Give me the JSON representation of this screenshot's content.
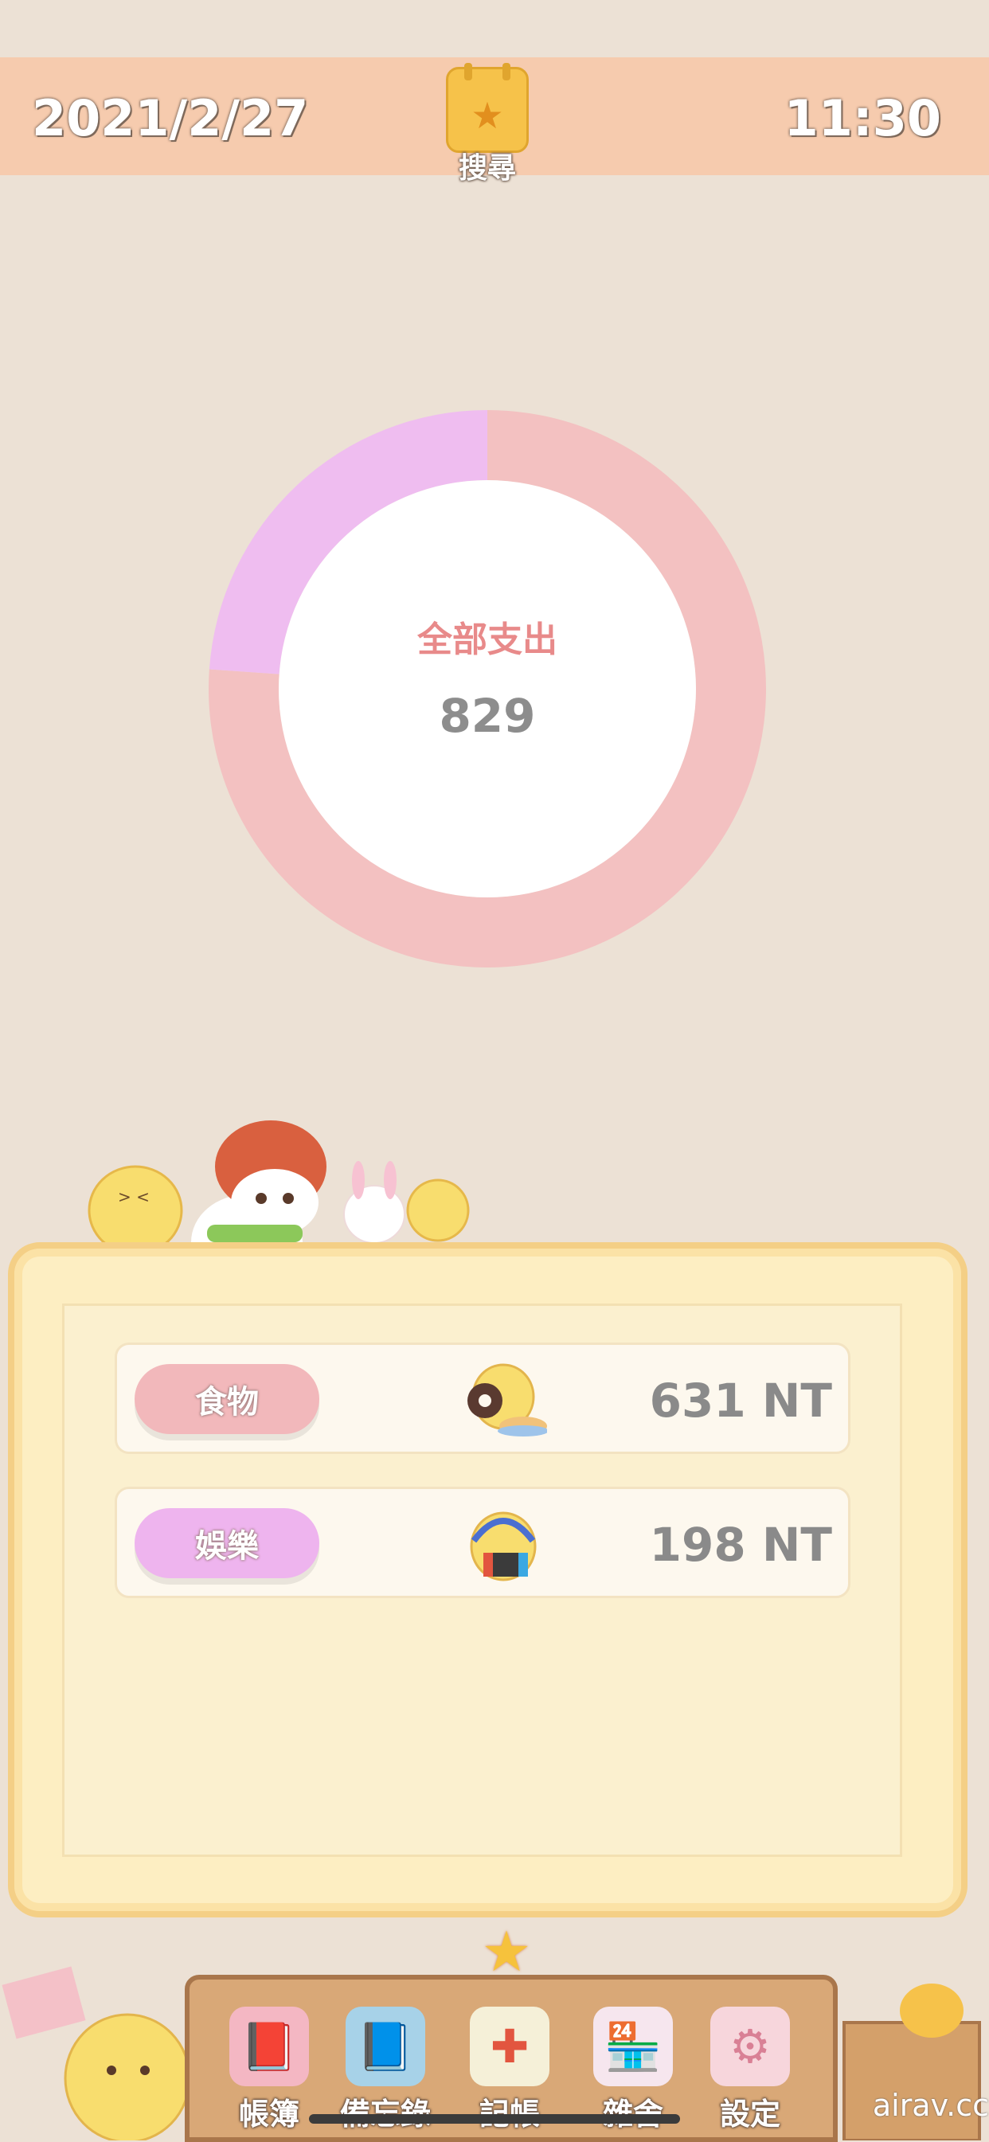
{
  "header": {
    "date": "2021/2/27",
    "time": "11:30",
    "search_label": "搜尋"
  },
  "summary": {
    "title": "全部支出",
    "total": "829"
  },
  "chart_data": {
    "type": "pie",
    "categories": [
      "食物",
      "娛樂"
    ],
    "values": [
      631,
      198
    ],
    "colors": [
      "#f3c1c1",
      "#efbdf0"
    ],
    "title": "",
    "style": "donut"
  },
  "expenses": [
    {
      "category": "食物",
      "amount": "631 NT",
      "color": "#f2b8bb",
      "icon": "donut-chick-icon"
    },
    {
      "category": "娛樂",
      "amount": "198 NT",
      "color": "#eeb4ee",
      "icon": "gamer-chick-icon"
    }
  ],
  "nav": {
    "items": [
      {
        "label": "帳簿",
        "icon": "ledger-book-icon"
      },
      {
        "label": "備忘錄",
        "icon": "memo-book-icon"
      },
      {
        "label": "記帳",
        "icon": "add-entry-icon"
      },
      {
        "label": "雜舍",
        "icon": "shop-icon"
      },
      {
        "label": "設定",
        "icon": "gear-icon"
      }
    ]
  },
  "watermark": "airav.cc"
}
